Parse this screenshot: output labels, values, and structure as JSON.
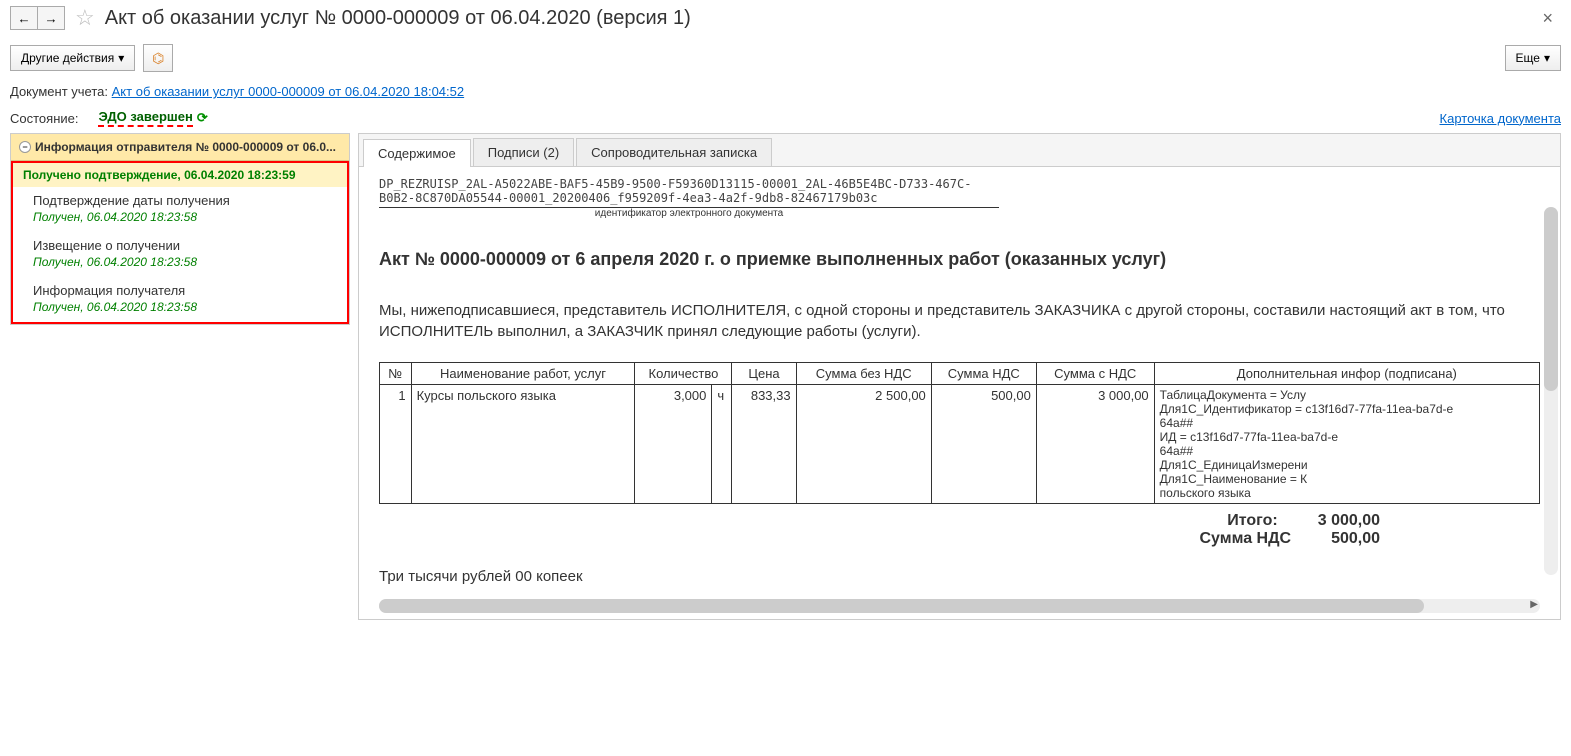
{
  "header": {
    "title": "Акт об оказании услуг № 0000-000009 от 06.04.2020 (версия 1)"
  },
  "toolbar": {
    "other_actions": "Другие действия",
    "more": "Еще"
  },
  "info": {
    "doc_label": "Документ учета:",
    "doc_link": "Акт об оказании услуг 0000-000009 от 06.04.2020 18:04:52",
    "status_label": "Состояние:",
    "status_value": "ЭДО завершен",
    "card_link": "Карточка документа"
  },
  "sidebar": {
    "header": "Информация отправителя № 0000-000009 от 06.0...",
    "confirm": "Получено подтверждение, 06.04.2020 18:23:59",
    "items": [
      {
        "label": "Подтверждение даты получения",
        "ts": "Получен, 06.04.2020 18:23:58"
      },
      {
        "label": "Извещение о получении",
        "ts": "Получен, 06.04.2020 18:23:58"
      },
      {
        "label": "Информация получателя",
        "ts": "Получен, 06.04.2020 18:23:58"
      }
    ]
  },
  "tabs": {
    "t1": "Содержимое",
    "t2": "Подписи (2)",
    "t3": "Сопроводительная записка"
  },
  "doc": {
    "id": "DP_REZRUISP_2AL-A5022ABE-BAF5-45B9-9500-F59360D13115-00001_2AL-46B5E4BC-D733-467C-B0B2-8C870DA05544-00001_20200406_f959209f-4ea3-4a2f-9db8-82467179b03c",
    "id_label": "идентификатор электронного документа",
    "title": "Акт № 0000-000009 от 6 апреля 2020 г. о приемке выполненных работ (оказанных услуг)",
    "text": "Мы, нижеподписавшиеся, представитель ИСПОЛНИТЕЛЯ, с одной стороны и представитель ЗАКАЗЧИКА с другой стороны, составили настоящий акт в том, что ИСПОЛНИТЕЛЬ выполнил, а ЗАКАЗЧИК принял следующие работы (услуги).",
    "cols": {
      "num": "№",
      "name": "Наименование работ, услуг",
      "qty": "Количество",
      "price": "Цена",
      "sum_no_vat": "Сумма без НДС",
      "vat": "Сумма НДС",
      "sum_vat": "Сумма с НДС",
      "extra": "Дополнительная инфор (подписана)"
    },
    "row": {
      "num": "1",
      "name": "Курсы польского языка",
      "qty": "3,000",
      "unit": "ч",
      "price": "833,33",
      "sum_no_vat": "2 500,00",
      "vat": "500,00",
      "sum_vat": "3 000,00",
      "extra": "ТаблицаДокумента = Услу\nДля1С_Идентификатор = c13f16d7-77fa-11ea-ba7d-e\n64a##\nИД = c13f16d7-77fa-11ea-ba7d-e\n64a##\nДля1С_ЕдиницаИзмерени\nДля1С_Наименование = К\nпольского языка"
    },
    "totals": {
      "total_label": "Итого:",
      "total_value": "3 000,00",
      "vat_label": "Сумма НДС",
      "vat_value": "500,00"
    },
    "words": "Три тысячи рублей 00 копеек"
  }
}
